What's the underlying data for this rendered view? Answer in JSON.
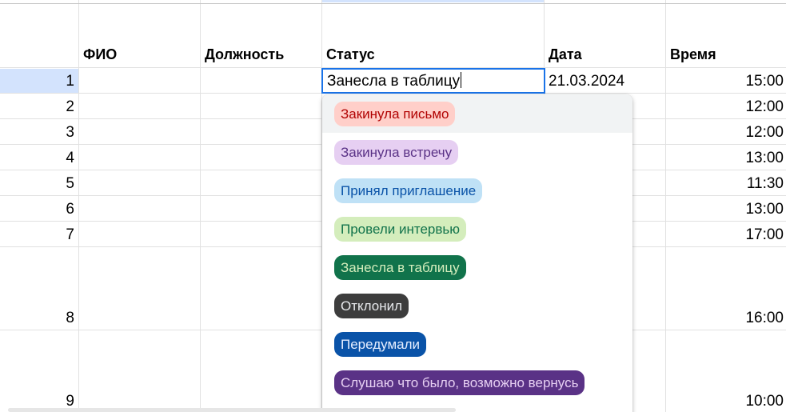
{
  "columns": {
    "fio": "ФИО",
    "position": "Должность",
    "status": "Статус",
    "date": "Дата",
    "time": "Время"
  },
  "rows": [
    {
      "num": "1",
      "date": "21.03.2024",
      "time": "15:00"
    },
    {
      "num": "2",
      "time": "12:00"
    },
    {
      "num": "3",
      "time": "12:00"
    },
    {
      "num": "4",
      "time": "13:00"
    },
    {
      "num": "5",
      "time": "11:30"
    },
    {
      "num": "6",
      "time": "13:00"
    },
    {
      "num": "7",
      "time": "17:00"
    },
    {
      "num": "8",
      "time": "16:00"
    },
    {
      "num": "9",
      "time": "10:00"
    }
  ],
  "active_cell": {
    "value": "Занесла в таблицу"
  },
  "dropdown": {
    "options": [
      {
        "label": "Закинула письмо",
        "bg": "#ffcfc9",
        "fg": "#b10202"
      },
      {
        "label": "Закинула встречу",
        "bg": "#e6cff2",
        "fg": "#5a3286"
      },
      {
        "label": "Принял приглашение",
        "bg": "#bfe1f6",
        "fg": "#0a53a8"
      },
      {
        "label": "Провели интервью",
        "bg": "#d4edbc",
        "fg": "#11734b"
      },
      {
        "label": "Занесла в таблицу",
        "bg": "#11734b",
        "fg": "#d4edbc"
      },
      {
        "label": "Отклонил",
        "bg": "#3d3d3d",
        "fg": "#e8eaed"
      },
      {
        "label": "Передумали",
        "bg": "#0a53a8",
        "fg": "#e5eeff"
      },
      {
        "label": "Слушаю что было, возможно вернусь",
        "bg": "#5a3286",
        "fg": "#e6cff2"
      }
    ]
  }
}
